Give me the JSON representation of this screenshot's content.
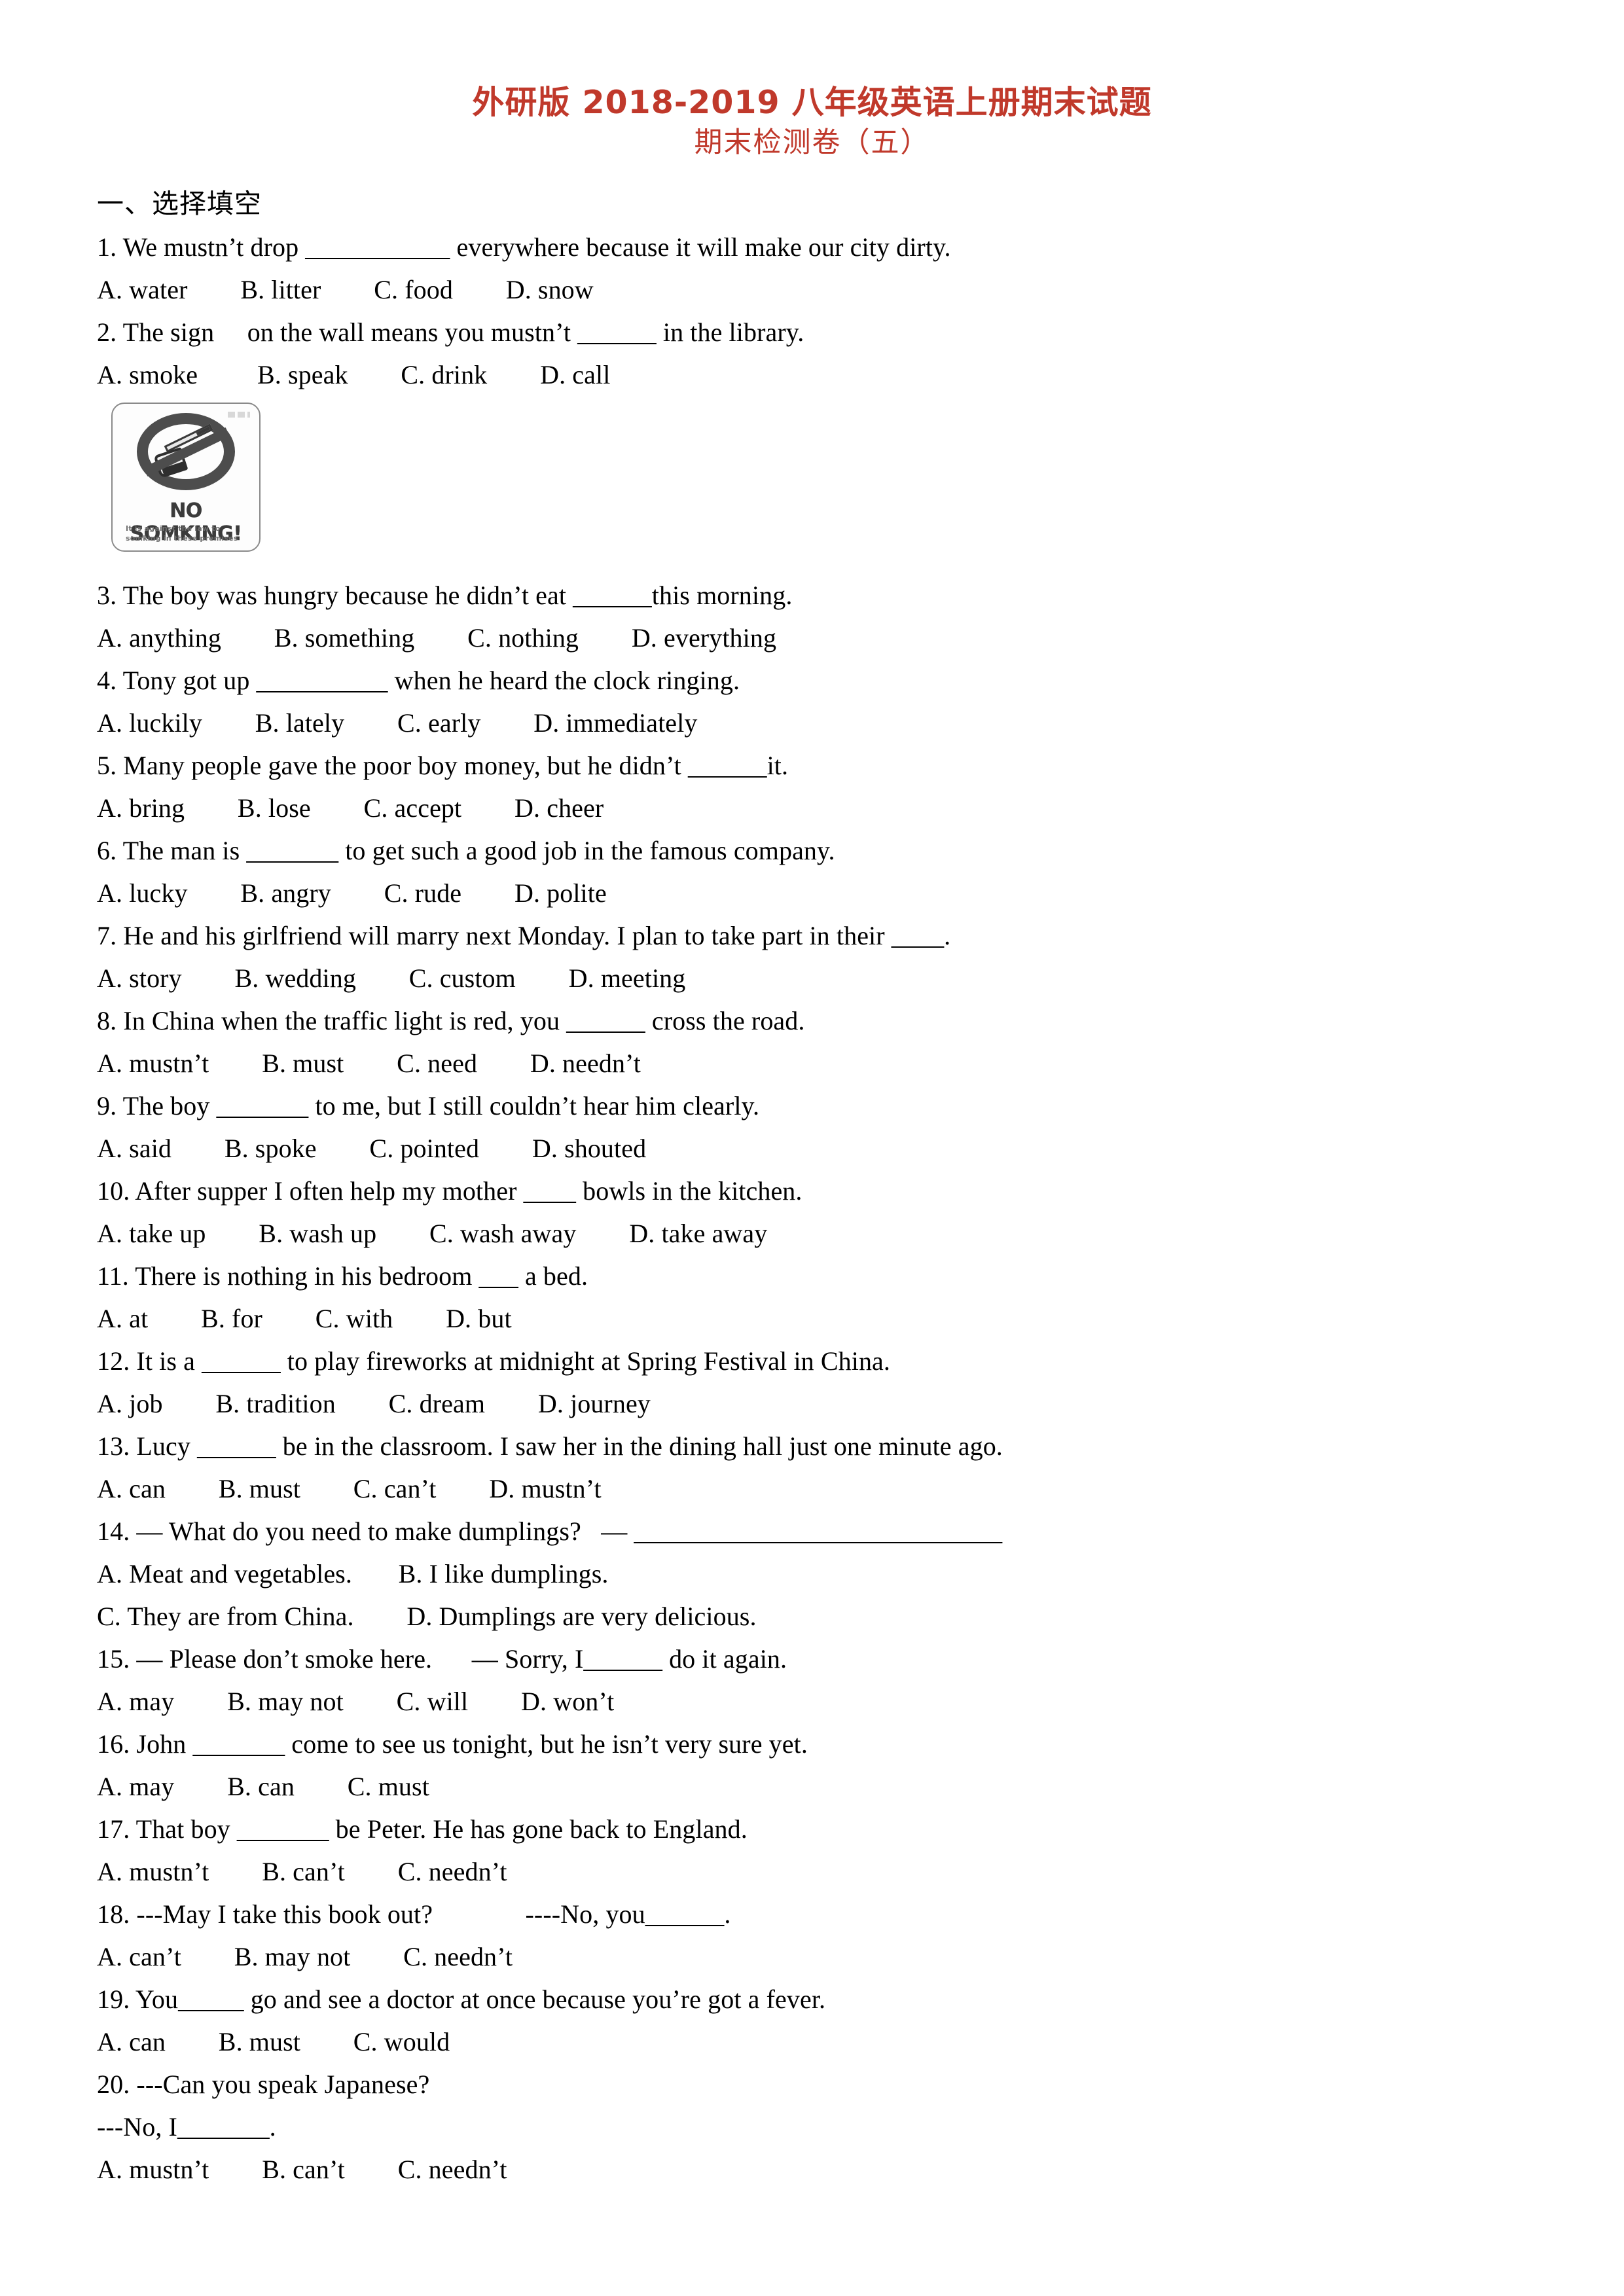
{
  "title": {
    "main": "外研版 2018-2019 八年级英语上册期末试题",
    "sub": "期末检测卷（五）",
    "color": "#c0392b"
  },
  "sections": [
    {
      "heading": "一、选择填空"
    }
  ],
  "questions": [
    {
      "stem": "1. We mustn’t drop ___________ everywhere because it will make our city dirty.",
      "options": "A. water        B. litter        C. food        D. snow"
    },
    {
      "stem": "2. The sign     on the wall means you mustn’t ______ in the library.",
      "options": "A. smoke         B. speak        C. drink        D. call"
    },
    {
      "stem": "3. The boy was hungry because he didn’t eat ______this morning.",
      "options": "A. anything        B. something        C. nothing        D. everything"
    },
    {
      "stem": "4. Tony got up __________ when he heard the clock ringing.",
      "options": "A. luckily        B. lately        C. early        D. immediately"
    },
    {
      "stem": "5. Many people gave the poor boy money, but he didn’t ______it.",
      "options": "A. bring        B. lose        C. accept        D. cheer"
    },
    {
      "stem": "6. The man is _______ to get such a good job in the famous company.",
      "options": "A. lucky        B. angry        C. rude        D. polite"
    },
    {
      "stem": "7. He and his girlfriend will marry next Monday. I plan to take part in their ____.",
      "options": "A. story        B. wedding        C. custom        D. meeting"
    },
    {
      "stem": "8. In China when the traffic light is red, you ______ cross the road.",
      "options": "A. mustn’t        B. must        C. need        D. needn’t"
    },
    {
      "stem": "9. The boy _______ to me, but I still couldn’t hear him clearly.",
      "options": "A. said        B. spoke        C. pointed        D. shouted"
    },
    {
      "stem": "10. After supper I often help my mother ____ bowls in the kitchen.",
      "options": "A. take up        B. wash up        C. wash away        D. take away"
    },
    {
      "stem": "11. There is nothing in his bedroom ___ a bed.",
      "options": "A. at        B. for        C. with        D. but"
    },
    {
      "stem": "12. It is a ______ to play fireworks at midnight at Spring Festival in China.",
      "options": "A. job        B. tradition        C. dream        D. journey"
    },
    {
      "stem": "13. Lucy ______ be in the classroom. I saw her in the dining hall just one minute ago.",
      "options": "A. can        B. must        C. can’t        D. mustn’t"
    },
    {
      "stem": "14. — What do you need to make dumplings?   — ____________________________",
      "options": "A. Meat and vegetables.       B. I like dumplings.",
      "options2": "C. They are from China.        D. Dumplings are very delicious."
    },
    {
      "stem": "15. — Please don’t smoke here.      — Sorry, I______ do it again.",
      "options": "A. may        B. may not        C. will        D. won’t"
    },
    {
      "stem": "16. John _______ come to see us tonight, but he isn’t very sure yet.",
      "options": "A. may        B. can        C. must"
    },
    {
      "stem": "17. That boy _______ be Peter. He has gone back to England.",
      "options": "A. mustn’t        B. can’t        C. needn’t"
    },
    {
      "stem": "18. ---May I take this book out?              ----No, you______.",
      "options": "A. can’t        B. may not        C. needn’t"
    },
    {
      "stem": "19. You_____ go and see a doctor at once because you’re got a fever.",
      "options": "A. can        B. must        C. would"
    },
    {
      "stem": "20. ---Can you speak Japanese?",
      "stem2": "---No, I_______.",
      "options": "A. mustn’t        B. can’t        C. needn’t"
    }
  ],
  "sign": {
    "title": "NO SOMKING!",
    "line1": "It is against the law to",
    "line2": "somking in these premises"
  }
}
